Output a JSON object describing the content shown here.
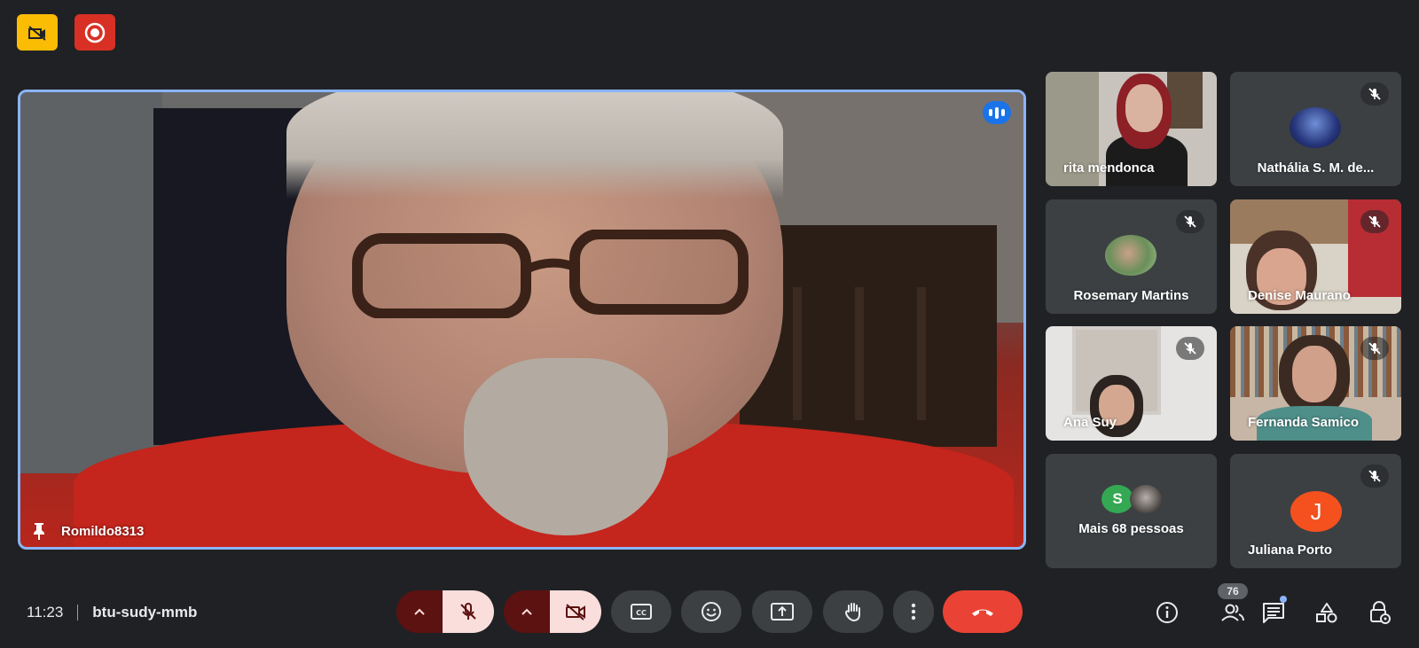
{
  "colors": {
    "background": "#202124",
    "tile": "#3c4043",
    "active_speaker_border": "#8ab4f8",
    "end_call": "#ea4335",
    "indicator_yellow": "#fbbc04",
    "recording_red": "#d93025"
  },
  "top_indicators": [
    {
      "icon": "camera-off-notice-icon"
    },
    {
      "icon": "recording-icon"
    }
  ],
  "main_speaker": {
    "name": "Romildo8313",
    "pinned": true,
    "speaking": true
  },
  "participants": [
    {
      "name": "rita mendonca",
      "video_on": true,
      "muted": false
    },
    {
      "name": "Nathália S. M. de...",
      "video_on": false,
      "muted": true
    },
    {
      "name": "Rosemary Martins",
      "video_on": false,
      "muted": true
    },
    {
      "name": "Denise Maurano",
      "video_on": true,
      "muted": true
    },
    {
      "name": "Ana Suy",
      "video_on": true,
      "muted": true
    },
    {
      "name": "Fernanda Samico",
      "video_on": true,
      "muted": true
    },
    {
      "name": "Mais 68 pessoas",
      "video_on": false,
      "muted": false,
      "avatar_letter": "S"
    },
    {
      "name": "Juliana Porto",
      "video_on": false,
      "muted": true,
      "avatar_letter": "J"
    }
  ],
  "bottom_bar": {
    "time": "11:23",
    "meeting_code": "btu-sudy-mmb",
    "controls": [
      "audio-options-icon",
      "mic-off-icon",
      "video-options-icon",
      "camera-off-icon",
      "captions-icon",
      "emoji-icon",
      "present-screen-icon",
      "raise-hand-icon",
      "more-options-icon",
      "end-call-icon"
    ],
    "right_icons": [
      "info-icon",
      "people-icon",
      "chat-icon",
      "activities-icon",
      "host-controls-icon"
    ],
    "people_count": "76"
  }
}
